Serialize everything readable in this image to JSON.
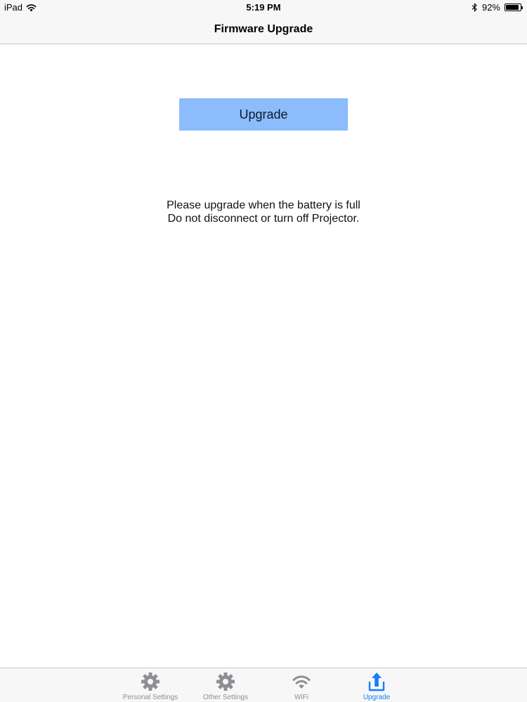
{
  "status_bar": {
    "device": "iPad",
    "time": "5:19 PM",
    "battery_percent": "92%",
    "battery_level": 0.92
  },
  "nav": {
    "title": "Firmware Upgrade"
  },
  "main": {
    "upgrade_button_label": "Upgrade",
    "notice_line1": "Please upgrade when the battery is full",
    "notice_line2": "Do not disconnect or turn off Projector."
  },
  "tabs": [
    {
      "label": "Personal Settings",
      "icon": "gear-icon",
      "active": false
    },
    {
      "label": "Other Settings",
      "icon": "gear-icon",
      "active": false
    },
    {
      "label": "WiFi",
      "icon": "wifi-icon",
      "active": false
    },
    {
      "label": "Upgrade",
      "icon": "upload-icon",
      "active": true
    }
  ],
  "colors": {
    "button_bg": "#8cbcfb",
    "tab_active": "#147efb",
    "tab_inactive": "#8e8e93",
    "bar_bg": "#f7f7f8"
  }
}
